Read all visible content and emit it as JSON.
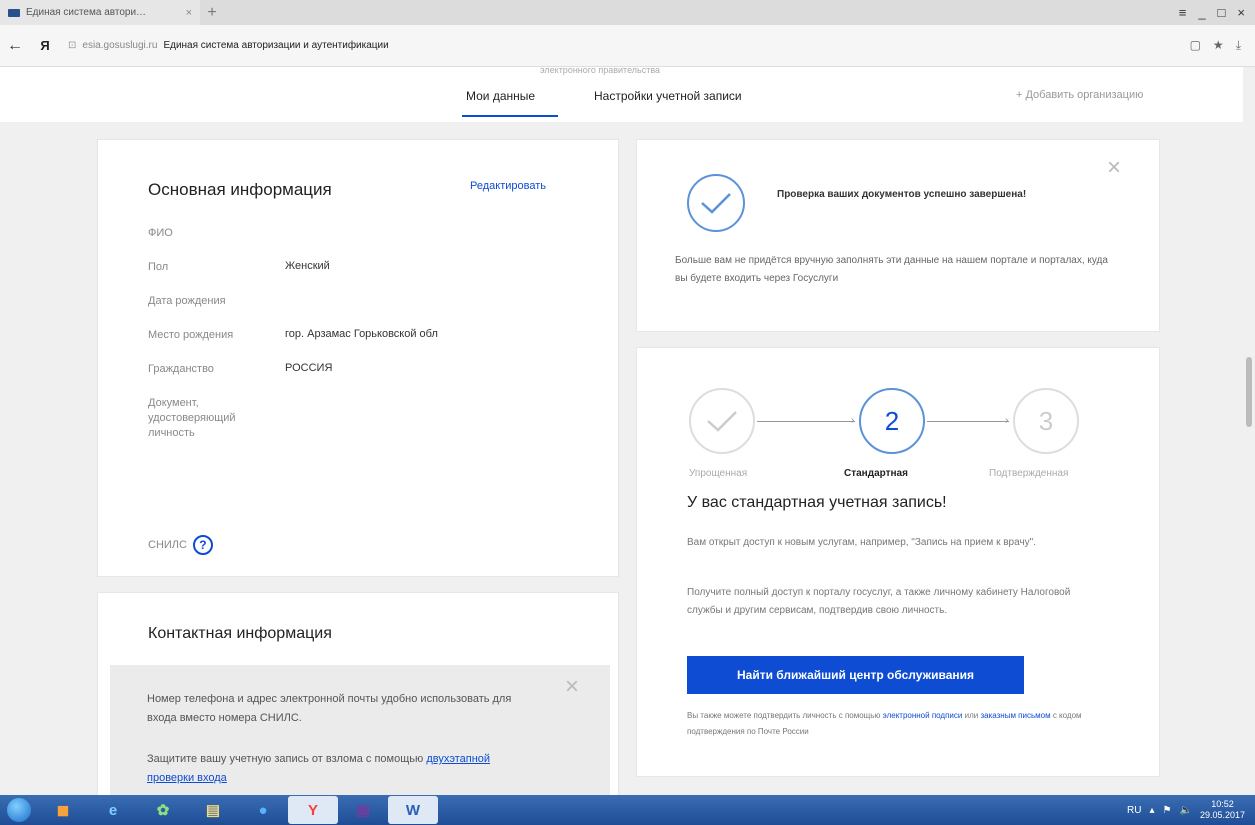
{
  "browser": {
    "tab_title": "Единая система автори…",
    "tab_close": "×",
    "new_tab": "+",
    "window_controls": [
      "≡",
      "_",
      "□",
      "×"
    ],
    "back": "←",
    "yandex_logo": "Я",
    "url_host": "esia.gosuslugi.ru",
    "page_title": "Единая система авторизации и аутентификации",
    "right_icons": [
      "▢",
      "★",
      "⤓"
    ]
  },
  "page": {
    "top_hint": "электронного правительства",
    "nav": {
      "my_data": "Мои данные",
      "account_settings": "Настройки учетной записи",
      "add_org": "+ Добавить организацию"
    },
    "main_info": {
      "title": "Основная информация",
      "edit": "Редактировать",
      "fio_label": "ФИО",
      "gender_label": "Пол",
      "gender_value": "Женский",
      "birth_date_label": "Дата рождения",
      "birth_place_label": "Место рождения",
      "birth_place_value": "гор. Арзамас Горьковской обл",
      "citizenship_label": "Гражданство",
      "citizenship_value": "РОССИЯ",
      "id_doc_label": "Документ, удостоверяющий личность",
      "snils_label": "СНИЛС",
      "help_icon": "?"
    },
    "contact_info": {
      "title": "Контактная информация",
      "note1": "Номер телефона и адрес электронной почты удобно использовать для входа вместо номера СНИЛС.",
      "note2_prefix": "Защитите вашу учетную запись от взлома с помощью",
      "note2_link": "двухэтапной проверки входа",
      "close": "×"
    },
    "verification": {
      "title": "Проверка ваших документов успешно завершена!",
      "text": "Больше вам не придётся вручную заполнять эти данные на нашем портале и порталах, куда вы будете входить через Госуслуги",
      "close": "×"
    },
    "account_level": {
      "step2_number": "2",
      "step3_number": "3",
      "step1_label": "Упрощенная",
      "step2_label": "Стандартная",
      "step3_label": "Подтвержденная",
      "title": "У вас стандартная учетная запись!",
      "p1": "Вам открыт доступ к новым услугам, например, \"Запись на прием к врачу\".",
      "p2": "Получите полный доступ к порталу госуслуг, а также личному кабинету Налоговой службы и другим сервисам, подтвердив свою личность.",
      "button": "Найти ближайший центр обслуживания",
      "p3_prefix": "Вы также можете подтвердить личность с помощью",
      "p3_link1": "электронной подписи",
      "p3_middle": "или",
      "p3_link2": "заказным письмом",
      "p3_suffix": "с кодом подтверждения по Почте России"
    }
  },
  "taskbar": {
    "apps": [
      "e",
      "✿",
      "▤",
      "●",
      "Y",
      "▣",
      "W"
    ],
    "lang": "RU",
    "time": "10:52",
    "date": "29.05.2017"
  },
  "colors": {
    "accent": "#0d4cd3",
    "circle_blue": "#5b92d8",
    "taskbar": "#1f4d95"
  }
}
